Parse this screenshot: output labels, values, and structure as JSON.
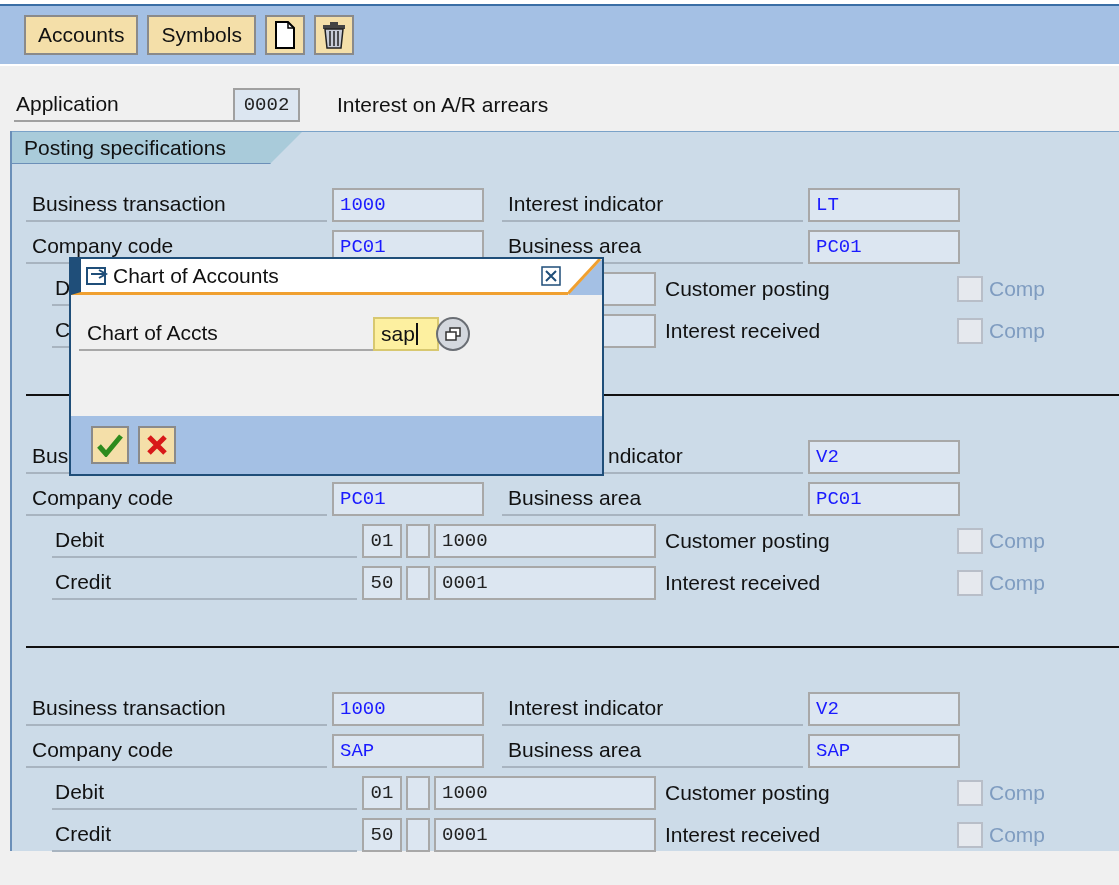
{
  "toolbar": {
    "buttons": [
      "Accounts",
      "Symbols"
    ]
  },
  "application": {
    "label": "Application",
    "value": "0002",
    "description": "Interest on A/R arrears"
  },
  "section_tab": "Posting specifications",
  "blocks": [
    {
      "rows": [
        {
          "kind": "main",
          "left": {
            "label": "Business transaction",
            "value": "1000"
          },
          "right": {
            "label": "Interest indicator",
            "value": "LT"
          }
        },
        {
          "kind": "main",
          "left": {
            "label": "Company code",
            "value": "PC01"
          },
          "right": {
            "label": "Business area",
            "value": "PC01"
          }
        },
        {
          "kind": "posting",
          "label": "D",
          "flag_label": "Customer posting",
          "flag": {
            "label": "Comp",
            "checked": false,
            "disabled": true
          }
        },
        {
          "kind": "posting",
          "label": "C",
          "flag_label": "Interest received",
          "flag": {
            "label": "Comp",
            "checked": false,
            "disabled": true
          }
        }
      ]
    },
    {
      "rows": [
        {
          "kind": "main",
          "left": {
            "label": "Bus"
          },
          "right": {
            "label": "ndicator",
            "cut_start": true,
            "value": "V2"
          }
        },
        {
          "kind": "main",
          "left": {
            "label": "Company code",
            "value": "PC01"
          },
          "right": {
            "label": "Business area",
            "value": "PC01"
          }
        },
        {
          "kind": "posting",
          "label": "Debit",
          "key": "01",
          "account": "1000",
          "flag_label": "Customer posting",
          "flag": {
            "label": "Comp",
            "checked": false,
            "disabled": true
          }
        },
        {
          "kind": "posting",
          "label": "Credit",
          "key": "50",
          "account": "0001",
          "flag_label": "Interest received",
          "flag": {
            "label": "Comp",
            "checked": false,
            "disabled": true
          }
        }
      ]
    },
    {
      "rows": [
        {
          "kind": "main",
          "left": {
            "label": "Business transaction",
            "value": "1000"
          },
          "right": {
            "label": "Interest indicator",
            "value": "V2"
          }
        },
        {
          "kind": "main",
          "left": {
            "label": "Company code",
            "value": "SAP"
          },
          "right": {
            "label": "Business area",
            "value": "SAP"
          }
        },
        {
          "kind": "posting",
          "label": "Debit",
          "key": "01",
          "account": "1000",
          "flag_label": "Customer posting",
          "flag": {
            "label": "Comp",
            "checked": false,
            "disabled": true
          }
        },
        {
          "kind": "posting",
          "label": "Credit",
          "key": "50",
          "account": "0001",
          "flag_label": "Interest received",
          "flag": {
            "label": "Comp",
            "checked": false,
            "disabled": true
          }
        }
      ]
    }
  ],
  "dialog": {
    "title": "Chart of Accounts",
    "field_label": "Chart of Accts",
    "value": "sap"
  }
}
